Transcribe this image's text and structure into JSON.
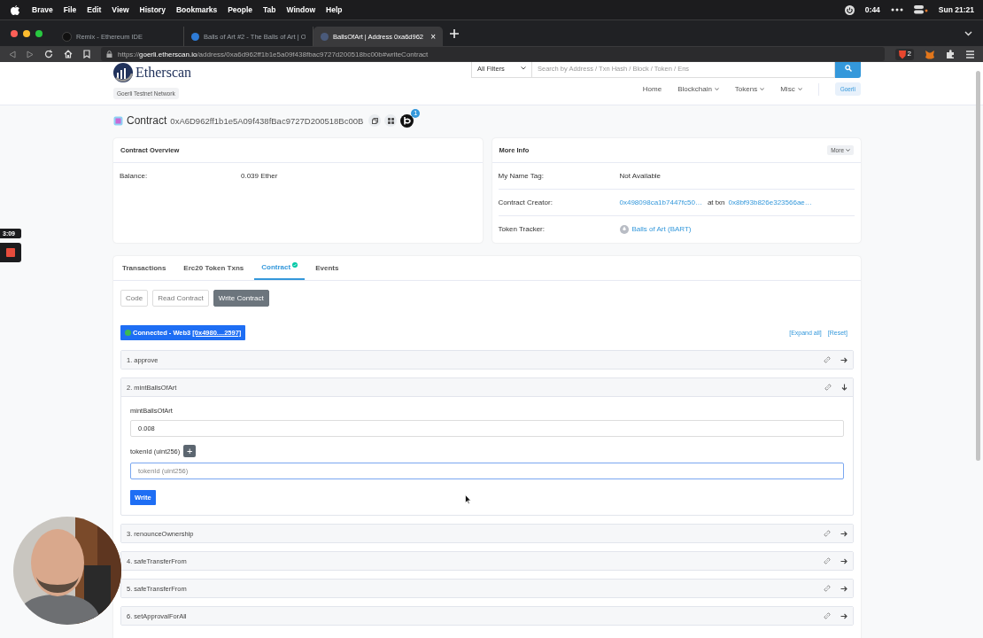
{
  "menubar": {
    "app": "Brave",
    "items": [
      "File",
      "Edit",
      "View",
      "History",
      "Bookmarks",
      "People",
      "Tab",
      "Window",
      "Help"
    ],
    "timer": "0:44",
    "clock": "Sun 21:21"
  },
  "browser": {
    "tabs": [
      {
        "title": "Remix - Ethereum IDE",
        "selected": false
      },
      {
        "title": "Balls of Art #2 - The Balls of Art | O",
        "selected": false
      },
      {
        "title": "BallsOfArt | Address 0xa6d962",
        "selected": true,
        "close_label": "×"
      }
    ],
    "url": {
      "scheme": "https://",
      "host": "goerli.etherscan.io",
      "path": "/address/0xa6d962ff1b1e5a09f438fbac9727d200518bc00b#writeContract"
    },
    "shield_count": "2"
  },
  "recorder": {
    "time": "3:09"
  },
  "header": {
    "logo": "Etherscan",
    "network": "Goerli Testnet Network",
    "filter": "All Filters",
    "search_placeholder": "Search by Address / Txn Hash / Block / Token / Ens",
    "nav": [
      {
        "label": "Home",
        "dropdown": false
      },
      {
        "label": "Blockchain",
        "dropdown": true
      },
      {
        "label": "Tokens",
        "dropdown": true
      },
      {
        "label": "Misc",
        "dropdown": true
      }
    ],
    "network_badge": "Goerli"
  },
  "contract": {
    "label": "Contract",
    "address": "0xA6D962ff1b1e5A09f438fBac9727D200518Bc00B",
    "badge": "1"
  },
  "overview": {
    "title": "Contract Overview",
    "rows": [
      {
        "label": "Balance:",
        "value": "0.039 Ether"
      }
    ]
  },
  "more_info": {
    "title": "More Info",
    "button": "More",
    "rows": [
      {
        "kind": "text",
        "label": "My Name Tag:",
        "value": "Not Available"
      },
      {
        "kind": "creator",
        "label": "Contract Creator:",
        "value": "0x498098ca1b7447fc50…",
        "middle": "at txn",
        "link": "0x8bf93b826e323566ae…"
      },
      {
        "kind": "token",
        "label": "Token Tracker:",
        "value": "Balls of Art (BART)"
      }
    ]
  },
  "tabs": [
    {
      "label": "Transactions",
      "selected": false,
      "verified": false
    },
    {
      "label": "Erc20 Token Txns",
      "selected": false,
      "verified": false
    },
    {
      "label": "Contract",
      "selected": true,
      "verified": true
    },
    {
      "label": "Events",
      "selected": false,
      "verified": false
    }
  ],
  "subtabs": [
    {
      "label": "Code",
      "selected": false
    },
    {
      "label": "Read Contract",
      "selected": false
    },
    {
      "label": "Write Contract",
      "selected": true
    }
  ],
  "connection": {
    "status": "Connected - Web3",
    "account": "[0x4980....2597]"
  },
  "actions": [
    "[Expand all]",
    "[Reset]"
  ],
  "functions": [
    {
      "title": "1. approve",
      "expanded": false
    },
    {
      "title": "2. mintBallsOfArt",
      "expanded": true,
      "inputs": [
        {
          "label": "mintBallsOfArt",
          "value": "0.008",
          "add_button": false,
          "focused": false
        },
        {
          "label": "tokenId (uint256)",
          "placeholder": "tokenId (uint256)",
          "add_button": true,
          "add_label": "+",
          "focused": true
        }
      ],
      "button": "Write"
    },
    {
      "title": "3. renounceOwnership",
      "expanded": false
    },
    {
      "title": "4. safeTransferFrom",
      "expanded": false
    },
    {
      "title": "5. safeTransferFrom",
      "expanded": false
    },
    {
      "title": "6. setApprovalForAll",
      "expanded": false
    }
  ]
}
